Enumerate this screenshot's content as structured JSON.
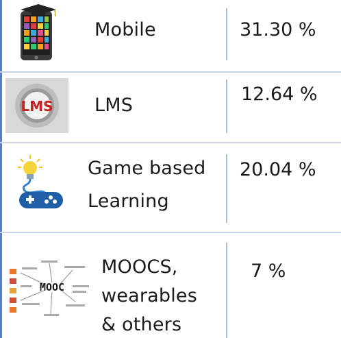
{
  "rows": [
    {
      "icon": "mobile-phone-graduation-cap-icon",
      "label": "Mobile",
      "value": "31.30 %"
    },
    {
      "icon": "lms-logo-icon",
      "logo_text": "LMS",
      "label": "LMS",
      "value": "12.64 %"
    },
    {
      "icon": "lightbulb-gamepad-icon",
      "label_lines": [
        "Game based",
        "Learning"
      ],
      "value": "20.04 %"
    },
    {
      "icon": "moocs-word-cloud-icon",
      "logo_text": "MOOC",
      "label_lines": [
        "MOOCS,",
        "wearables",
        "& others"
      ],
      "value": "7 %"
    }
  ],
  "colors": {
    "frame": "#5b7fb8",
    "row_separator": "#c9d3e3",
    "column_separator": "#a9bcd8"
  }
}
